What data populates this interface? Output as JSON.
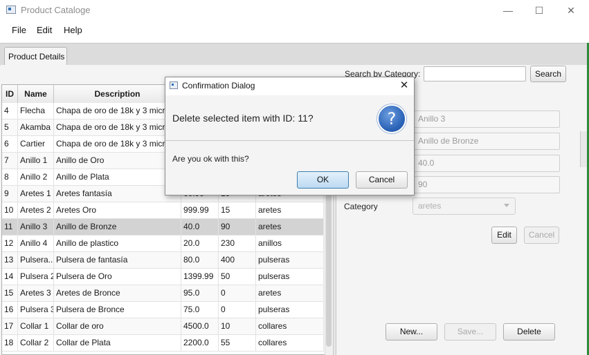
{
  "window": {
    "title": "Product Cataloge",
    "minimize": "—",
    "maximize": "☐",
    "close": "✕"
  },
  "menu": {
    "file": "File",
    "edit": "Edit",
    "help": "Help"
  },
  "tab": {
    "label": "Product Details"
  },
  "search": {
    "label": "Search by Category:",
    "value": "",
    "button": "Search"
  },
  "table": {
    "columns": [
      "ID",
      "Name",
      "Description",
      "",
      "",
      ""
    ],
    "rows": [
      [
        "4",
        "Flecha",
        "Chapa de oro de 18k y 3 micras",
        "",
        "",
        ""
      ],
      [
        "5",
        "Akamba",
        "Chapa de oro de 18k y 3 micras",
        "",
        "",
        ""
      ],
      [
        "6",
        "Cartier",
        "Chapa de oro de 18k y 3 micras",
        "",
        "",
        ""
      ],
      [
        "7",
        "Anillo 1",
        "Anillo de Oro",
        "",
        "",
        ""
      ],
      [
        "8",
        "Anillo 2",
        "Anillo de Plata",
        "",
        "",
        ""
      ],
      [
        "9",
        "Aretes 1",
        "Aretes fantasía",
        "60.99",
        "15",
        "aretes"
      ],
      [
        "10",
        "Aretes 2",
        "Aretes Oro",
        "999.99",
        "15",
        "aretes"
      ],
      [
        "11",
        "Anillo 3",
        "Anillo de Bronze",
        "40.0",
        "90",
        "aretes"
      ],
      [
        "12",
        "Anillo 4",
        "Anillo de plastico",
        "20.0",
        "230",
        "anillos"
      ],
      [
        "13",
        "Pulsera...",
        "Pulsera de fantasía",
        "80.0",
        "400",
        "pulseras"
      ],
      [
        "14",
        "Pulsera 2",
        "Pulsera de Oro",
        "1399.99",
        "50",
        "pulseras"
      ],
      [
        "15",
        "Aretes 3",
        "Aretes de Bronce",
        "95.0",
        "0",
        "aretes"
      ],
      [
        "16",
        "Pulsera 3",
        "Pulsera de Bronce",
        "75.0",
        "0",
        "pulseras"
      ],
      [
        "17",
        "Collar 1",
        "Collar de oro",
        "4500.0",
        "10",
        "collares"
      ],
      [
        "18",
        "Collar 2",
        "Collar de Plata",
        "2200.0",
        "55",
        "collares"
      ]
    ],
    "selected_row_id": "11"
  },
  "form": {
    "name_value": "Anillo 3",
    "description_value": "Anillo de Bronze",
    "price_value": "40.0",
    "quantity_value": "90",
    "category_label": "Category",
    "category_value": "aretes",
    "edit_button": "Edit",
    "cancel_button": "Cancel",
    "new_button": "New...",
    "save_button": "Save...",
    "delete_button": "Delete"
  },
  "dialog": {
    "title": "Confirmation Dialog",
    "close": "✕",
    "header": "Delete selected item with ID: 11?",
    "icon_glyph": "?",
    "content": "Are you ok with this?",
    "ok_button": "OK",
    "cancel_button": "Cancel"
  },
  "colors": {
    "accent": "#3c7fb1",
    "question_icon": "#2a62b6",
    "selected_row": "#d3d3d3"
  }
}
